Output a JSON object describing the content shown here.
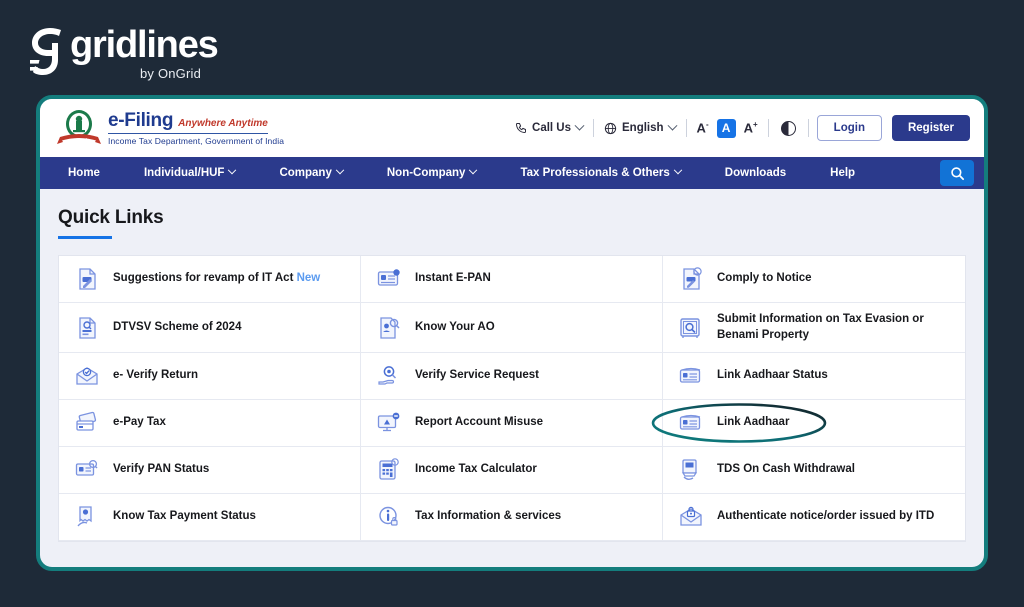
{
  "brand": {
    "name": "gridlines",
    "tagline": "by OnGrid",
    "logo_icon": "gridlines-g-icon"
  },
  "site_header": {
    "emblem_icon": "india-national-emblem-icon",
    "title": "e-Filing",
    "tagline": "Anywhere Anytime",
    "department": "Income Tax Department, Government of India",
    "call_us": {
      "label": "Call Us",
      "icon": "phone-icon",
      "chevron": "chevron-down-icon"
    },
    "language": {
      "label": "English",
      "icon": "globe-icon",
      "chevron": "chevron-down-icon"
    },
    "font_size": {
      "decrease": "A",
      "decrease_sup": "-",
      "normal": "A",
      "increase": "A",
      "increase_sup": "+"
    },
    "contrast_icon": "contrast-toggle-icon",
    "login_label": "Login",
    "register_label": "Register"
  },
  "nav": {
    "items": [
      {
        "label": "Home",
        "has_dropdown": false
      },
      {
        "label": "Individual/HUF",
        "has_dropdown": true
      },
      {
        "label": "Company",
        "has_dropdown": true
      },
      {
        "label": "Non-Company",
        "has_dropdown": true
      },
      {
        "label": "Tax Professionals & Others",
        "has_dropdown": true
      },
      {
        "label": "Downloads",
        "has_dropdown": false
      },
      {
        "label": "Help",
        "has_dropdown": false
      }
    ],
    "search_icon": "search-icon"
  },
  "quick_links": {
    "title": "Quick Links",
    "items": [
      {
        "label": "Suggestions for revamp of IT Act",
        "badge": "New",
        "icon": "document-edit-icon"
      },
      {
        "label": "Instant E-PAN",
        "icon": "id-card-icon"
      },
      {
        "label": "Comply to Notice",
        "icon": "notice-document-icon"
      },
      {
        "label": "DTVSV Scheme of 2024",
        "icon": "document-search-icon"
      },
      {
        "label": "Know Your AO",
        "icon": "person-document-search-icon"
      },
      {
        "label": "Submit Information on Tax Evasion or Benami Property",
        "icon": "safe-search-icon"
      },
      {
        "label": "e- Verify Return",
        "icon": "mail-verify-icon"
      },
      {
        "label": "Verify Service Request",
        "icon": "hand-gear-search-icon"
      },
      {
        "label": "Link Aadhaar Status",
        "icon": "aadhaar-card-icon"
      },
      {
        "label": "e-Pay Tax",
        "icon": "wallet-cards-icon"
      },
      {
        "label": "Report Account Misuse",
        "icon": "monitor-alert-icon"
      },
      {
        "label": "Link Aadhaar",
        "icon": "aadhaar-card-icon",
        "highlighted": true
      },
      {
        "label": "Verify PAN Status",
        "icon": "pan-card-search-icon"
      },
      {
        "label": "Income Tax Calculator",
        "icon": "calculator-icon"
      },
      {
        "label": "TDS On Cash Withdrawal",
        "icon": "atm-cash-icon"
      },
      {
        "label": "Know Tax Payment Status",
        "icon": "hand-receipt-icon"
      },
      {
        "label": "Tax Information & services",
        "icon": "info-lock-icon"
      },
      {
        "label": "Authenticate notice/order issued by ITD",
        "icon": "mail-lock-icon"
      }
    ]
  },
  "annotation": {
    "type": "ellipse-highlight",
    "target": "Link Aadhaar",
    "color_start": "#0f7d7d",
    "color_end": "#14161c"
  },
  "colors": {
    "page_background": "#1e2a38",
    "frame_border": "#147d7d",
    "nav_background": "#2b3a8c",
    "accent_blue": "#1673e6",
    "panel_background": "#eef0f7"
  }
}
